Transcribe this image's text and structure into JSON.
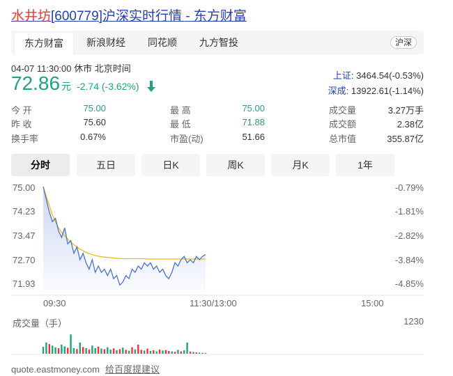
{
  "title": {
    "name": "水井坊",
    "code": "[600779]",
    "rest": "沪深实时行情 - 东方财富"
  },
  "sources": [
    "东方财富",
    "新浪财经",
    "同花顺",
    "九方智投"
  ],
  "market_badge": "沪深",
  "status_time": "04-07 11:30:00  休市  北京时间",
  "price": {
    "value": "72.86",
    "unit": "元",
    "change": "-2.74 (-3.62%)"
  },
  "indices": [
    {
      "label": "上证:",
      "value": "3464.54(-0.53%)"
    },
    {
      "label": "深成:",
      "value": "13922.61(-1.14%)"
    }
  ],
  "stats": [
    {
      "label": "今 开",
      "value": "75.00",
      "color": "green"
    },
    {
      "label": "最 高",
      "value": "75.00",
      "color": "green"
    },
    {
      "label": "成交量",
      "value": "3.27万手",
      "color": "normal"
    },
    {
      "label": "昨 收",
      "value": "75.60",
      "color": "normal"
    },
    {
      "label": "最 低",
      "value": "71.88",
      "color": "green"
    },
    {
      "label": "成交额",
      "value": "2.38亿",
      "color": "normal"
    },
    {
      "label": "换手率",
      "value": "0.67%",
      "color": "normal"
    },
    {
      "label": "市盈(动)",
      "value": "51.66",
      "color": "normal"
    },
    {
      "label": "总市值",
      "value": "355.87亿",
      "color": "normal"
    }
  ],
  "period_tabs": [
    "分时",
    "五日",
    "日K",
    "周K",
    "月K",
    "1年"
  ],
  "price_axis": [
    "75.00",
    "74.23",
    "73.47",
    "72.70",
    "71.93"
  ],
  "pct_axis": [
    "-0.79%",
    "-1.81%",
    "-2.82%",
    "-3.84%",
    "-4.85%"
  ],
  "time_axis": [
    "09:30",
    "11:30/13:00",
    "15:00"
  ],
  "volume": {
    "label": "成交量（手）",
    "max": "1230"
  },
  "footer": {
    "domain": "quote.eastmoney.com",
    "suggest": "给百度提建议"
  },
  "colors": {
    "down": "#1fa37b",
    "up": "#f73131",
    "price_line": "#4a6fd8",
    "avg_line": "#f0b90b"
  },
  "chart_data": {
    "type": "line",
    "x_range": [
      "09:30",
      "15:00"
    ],
    "ylim": [
      71.93,
      75.0
    ],
    "series": [
      {
        "values": [
          75.0,
          74.6,
          74.2,
          73.9,
          74.0,
          73.6,
          73.4,
          73.7,
          73.2,
          73.3,
          72.9,
          73.1,
          72.7,
          72.9,
          72.6,
          72.4,
          72.7,
          72.3,
          72.5,
          72.3,
          72.4,
          72.2,
          72.4,
          72.1,
          72.2,
          71.9,
          72.0,
          72.2,
          72.1,
          72.4,
          72.3,
          72.5,
          72.4,
          72.6,
          72.5,
          72.6,
          72.4,
          72.5,
          72.3,
          72.4,
          72.2,
          72.1,
          72.3,
          72.6,
          72.5,
          72.7,
          72.8,
          72.6,
          72.7,
          72.6,
          72.8,
          72.7,
          72.8,
          72.86
        ]
      },
      {
        "values": [
          75.0,
          74.7,
          74.4,
          74.1,
          73.9,
          73.7,
          73.55,
          73.45,
          73.35,
          73.25,
          73.17,
          73.1,
          73.03,
          72.98,
          72.93,
          72.89,
          72.86,
          72.83,
          72.81,
          72.79,
          72.78,
          72.77,
          72.76,
          72.75,
          72.74,
          72.74,
          72.73,
          72.73,
          72.73,
          72.73,
          72.73,
          72.73,
          72.73,
          72.73,
          72.72,
          72.72,
          72.72,
          72.72,
          72.72,
          72.72,
          72.72,
          72.72,
          72.72,
          72.72,
          72.72,
          72.72,
          72.72,
          72.72,
          72.72,
          72.72,
          72.72,
          72.72,
          72.72,
          72.72
        ]
      }
    ],
    "volume_values": [
      320,
      520,
      450,
      380,
      300,
      260,
      420,
      340,
      280,
      900,
      260,
      220,
      520,
      310,
      260,
      200,
      380,
      260,
      330,
      240,
      210,
      300,
      190,
      250,
      160,
      210,
      280,
      180,
      140,
      300,
      200,
      420,
      180,
      150,
      240,
      130,
      160,
      110,
      190,
      150,
      170,
      130,
      110,
      90,
      180,
      110,
      160,
      520,
      100,
      80,
      60,
      50,
      40,
      35
    ],
    "volume_up": [
      false,
      false,
      true,
      false,
      false,
      true,
      false,
      false,
      true,
      false,
      false,
      true,
      false,
      true,
      false,
      true,
      false,
      false,
      true,
      false,
      true,
      false,
      false,
      true,
      false,
      true,
      false,
      true,
      false,
      true,
      false,
      true,
      true,
      false,
      true,
      false,
      true,
      false,
      true,
      false,
      true,
      true,
      false,
      true,
      false,
      true,
      false,
      false,
      true,
      false,
      true,
      false,
      true,
      false
    ]
  }
}
